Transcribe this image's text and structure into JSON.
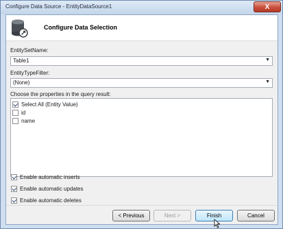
{
  "window": {
    "title": "Configure Data Source - EntityDataSource1",
    "close_glyph": "X"
  },
  "header": {
    "title": "Configure Data Selection",
    "icon": "database-icon"
  },
  "entity_set": {
    "label": "EntitySetName:",
    "value": "Table1"
  },
  "entity_type": {
    "label": "EntityTypeFilter:",
    "value": "(None)"
  },
  "properties": {
    "label": "Choose the properties in the query result:",
    "items": [
      {
        "label": "Select All (Entity Value)",
        "checked": true
      },
      {
        "label": "id",
        "checked": false
      },
      {
        "label": "name",
        "checked": false
      }
    ]
  },
  "options": [
    {
      "label": "Enable automatic inserts",
      "checked": true
    },
    {
      "label": "Enable automatic updates",
      "checked": true
    },
    {
      "label": "Enable automatic deletes",
      "checked": true
    }
  ],
  "buttons": {
    "previous": "< Previous",
    "next": "Next >",
    "finish": "Finish",
    "cancel": "Cancel"
  }
}
